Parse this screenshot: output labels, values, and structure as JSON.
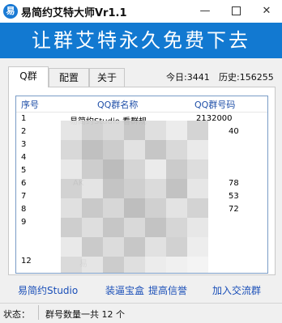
{
  "window": {
    "title": "易简约艾特大师Vr1.1",
    "icon_glyph": "易",
    "controls": {
      "minimize": "—",
      "maximize": "max-box",
      "close": "✕"
    }
  },
  "banner": {
    "text": "让群艾特永久免费下去",
    "color": "#1279d1"
  },
  "tabs": [
    {
      "label": "Q群",
      "active": true
    },
    {
      "label": "配置",
      "active": false
    },
    {
      "label": "关于",
      "active": false
    }
  ],
  "stats": {
    "today_label": "今日:",
    "today_value": "3441",
    "history_label": "历史:",
    "history_value": "156255"
  },
  "list": {
    "columns": [
      "序号",
      "QQ群名称",
      "QQ群号码"
    ],
    "rows": [
      {
        "index": "1",
        "name": "易简约Studio  看群规",
        "number": "2132000"
      },
      {
        "index": "2",
        "name": "",
        "number": ""
      },
      {
        "index": "3",
        "name": "",
        "number": ""
      },
      {
        "index": "4",
        "name": "",
        "number": ""
      },
      {
        "index": "5",
        "name": "",
        "number": ""
      },
      {
        "index": "6",
        "name": "",
        "number": ""
      },
      {
        "index": "7",
        "name": "",
        "number": ""
      },
      {
        "index": "8",
        "name": "",
        "number": ""
      },
      {
        "index": "9",
        "name": "",
        "number": ""
      },
      {
        "index": "",
        "name": "",
        "number": ""
      },
      {
        "index": "",
        "name": "",
        "number": ""
      },
      {
        "index": "12",
        "name": "",
        "number": ""
      }
    ],
    "partial_glimpses": {
      "row2_number_tail": "40",
      "row6_name_head": "AK",
      "row6_number_tail": "78",
      "row7_number_tail": "53",
      "row8_number_tail": "72",
      "row12_name_head": "易"
    }
  },
  "links": [
    "易简约Studio",
    "装逼宝盒",
    "提高信誉",
    "加入交流群"
  ],
  "status": {
    "label": "状态：",
    "text": "群号数量一共 12 个"
  }
}
